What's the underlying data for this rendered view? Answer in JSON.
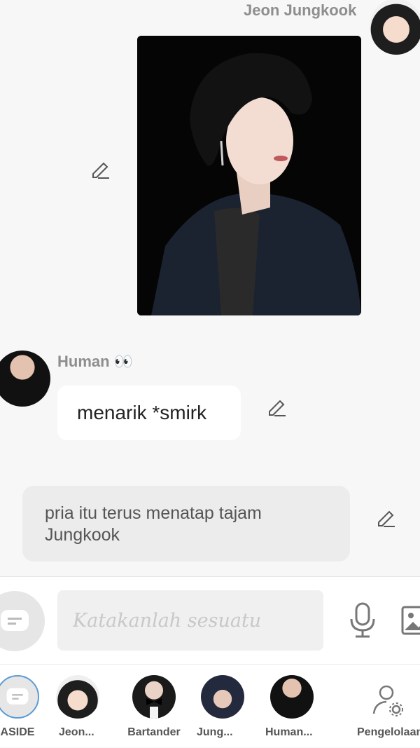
{
  "chat": {
    "char_message": {
      "sender": "Jeon Jungkook"
    },
    "user_message": {
      "sender": "Human 👀",
      "text": "menarik *smirk"
    },
    "narration": {
      "text": "pria itu terus menatap tajam Jungkook"
    }
  },
  "input": {
    "placeholder": "Katakanlah sesuatu"
  },
  "bottom_nav": {
    "items": [
      {
        "label": "ASIDE",
        "icon": "chat-bubble-icon"
      },
      {
        "label": "Jeon..."
      },
      {
        "label": "Bartander"
      },
      {
        "label": "Jung..."
      },
      {
        "label": "Human..."
      },
      {
        "label": "Pengelolaan",
        "icon": "user-settings-icon"
      }
    ]
  },
  "colors": {
    "background": "#f7f7f7",
    "bubble_user": "#ffffff",
    "bubble_narration": "#ececec",
    "name_gray": "#8e8e8e",
    "aside_accent": "#5b9bd5"
  }
}
